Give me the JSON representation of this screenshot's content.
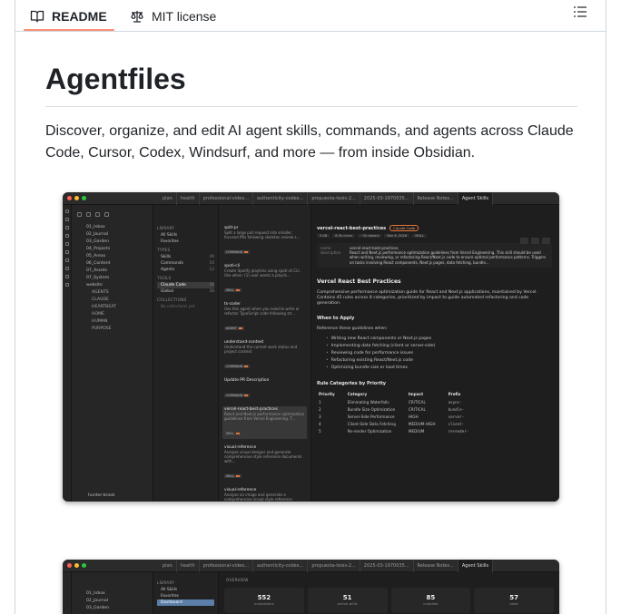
{
  "tabs": [
    {
      "label": "README",
      "icon": "book-icon",
      "active": true
    },
    {
      "label": "MIT license",
      "icon": "scale-icon",
      "active": false
    }
  ],
  "outline_icon": "list-icon",
  "readme": {
    "title": "Agentfiles",
    "description": "Discover, organize, and edit AI agent skills, commands, and agents across Claude Code, Cursor, Codex, Windsurf, and more — from inside Obsidian."
  },
  "colors": {
    "tab_underline": "#fd8c73",
    "accent_orange": "#e5743a",
    "app_bg": "#1e1e1e"
  },
  "screenshot1": {
    "window_tabs": [
      "plan",
      "health",
      "professional-video...",
      "authenticity-codex...",
      "propuesta-tesis-2...",
      "2025-03-1970035...",
      "Release Notes...",
      "Agent Skills"
    ],
    "filetree": [
      "01_Inbox",
      "02_Journal",
      "03_Garden",
      "04_Projects",
      "05_Areas",
      "06_Content",
      "07_Assets",
      "07_System",
      "website",
      "AGENTS",
      "CLAUDE",
      "HEARTBEAT",
      "HOME",
      "HUMAN",
      "PURPOSE"
    ],
    "footer": "hunter-brook",
    "library": {
      "heading": "LIBRARY",
      "items": [
        {
          "label": "All Skills"
        },
        {
          "label": "Favorites"
        }
      ],
      "types_heading": "TYPES",
      "types": [
        {
          "label": "Skills",
          "count": "46"
        },
        {
          "label": "Commands",
          "count": "16"
        },
        {
          "label": "Agents",
          "count": "12"
        }
      ],
      "tools_heading": "TOOLS",
      "tools": [
        {
          "label": "Claude Code",
          "count": "38"
        },
        {
          "label": "Global",
          "count": "38"
        }
      ],
      "collections_heading": "COLLECTIONS",
      "collections_empty": "No collections yet"
    },
    "list": [
      {
        "title": "split-pr",
        "desc": "Split a large pull request into smaller, focused PRs following skeleton review s...",
        "kind": "COMMAND"
      },
      {
        "title": "spoti-cli",
        "desc": "Create Spotify playlists using spoti-cli CLI. Use when: (1) user wants a playlis...",
        "kind": "SKILL"
      },
      {
        "title": "ts-coder",
        "desc": "Use this agent when you need to write or refactor TypeScript code following str...",
        "kind": "AGENT"
      },
      {
        "title": "understand-context",
        "desc": "Understand the current work status and project context",
        "kind": "COMMAND"
      },
      {
        "title": "Update PR Description",
        "desc": "",
        "kind": "COMMAND"
      },
      {
        "title": "vercel-react-best-practices",
        "desc": "React and Next.js performance optimization guidelines from Vercel Engineering. T...",
        "kind": "SKILL",
        "selected": true
      },
      {
        "title": "visual-reference",
        "desc": "Analyze visual designs and generate comprehensive style reference documents with...",
        "kind": "SKILL"
      },
      {
        "title": "visual-reference",
        "desc": "Analyze an image and generate a comprehensive visual style reference document...",
        "kind": "SKILL"
      }
    ],
    "detail": {
      "title": "vercel-react-best-practices",
      "badge": "Claude Code",
      "chips": [
        "5 KB",
        "8.3k chars",
        "~2k tokens",
        "Mar 6, 2026",
        "SKILL"
      ],
      "meta": [
        {
          "k": "name",
          "v": "vercel-react-best-practices"
        },
        {
          "k": "description",
          "v": "React and Next.js performance optimization guidelines from Vercel Engineering. This skill should be used when writing, reviewing, or refactoring React/Next.js code to ensure optimal performance patterns. Triggers on tasks involving React components, Next.js pages, data fetching, bundle..."
        }
      ],
      "h1": "Vercel React Best Practices",
      "intro": "Comprehensive performance optimization guide for React and Next.js applications, maintained by Vercel. Contains 45 rules across 8 categories, prioritized by impact to guide automated refactoring and code generation.",
      "when_h": "When to Apply",
      "when_p": "Reference these guidelines when:",
      "bullets": [
        "Writing new React components or Next.js pages",
        "Implementing data fetching (client or server-side)",
        "Reviewing code for performance issues",
        "Refactoring existing React/Next.js code",
        "Optimizing bundle size or load times"
      ],
      "rules_h": "Rule Categories by Priority",
      "table_head": [
        "Priority",
        "Category",
        "Impact",
        "Prefix"
      ],
      "table_rows": [
        [
          "1",
          "Eliminating Waterfalls",
          "CRITICAL",
          "async-"
        ],
        [
          "2",
          "Bundle Size Optimization",
          "CRITICAL",
          "bundle-"
        ],
        [
          "3",
          "Server-Side Performance",
          "HIGH",
          "server-"
        ],
        [
          "4",
          "Client-Side Data Fetching",
          "MEDIUM-HIGH",
          "client-"
        ],
        [
          "5",
          "Re-render Optimization",
          "MEDIUM",
          "rerender-"
        ]
      ]
    }
  },
  "screenshot2": {
    "library": [
      {
        "label": "All Skills"
      },
      {
        "label": "Favorites"
      },
      {
        "label": "Dashboard"
      }
    ],
    "overview_heading": "OVERVIEW",
    "stats": [
      {
        "value": "552",
        "label": "invocations"
      },
      {
        "value": "51",
        "label": "active skills"
      },
      {
        "value": "85",
        "label": "installed"
      },
      {
        "value": "57",
        "label": "stale"
      }
    ]
  }
}
